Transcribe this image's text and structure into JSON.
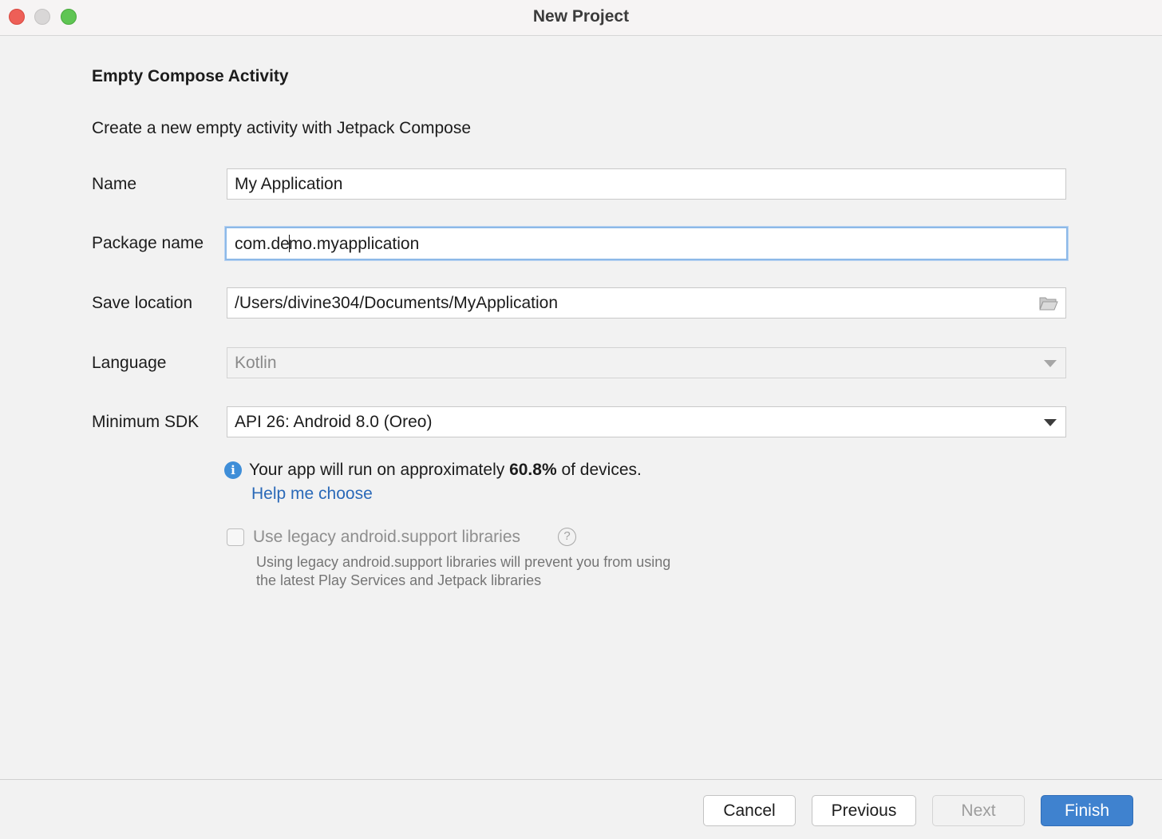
{
  "window": {
    "title": "New Project"
  },
  "section": {
    "title": "Empty Compose Activity",
    "description": "Create a new empty activity with Jetpack Compose"
  },
  "form": {
    "name_label": "Name",
    "name_value": "My Application",
    "package_label": "Package name",
    "package_value_before_caret": "com.de",
    "package_value_after_caret": "mo.myapplication",
    "save_location_label": "Save location",
    "save_location_value": "/Users/divine304/Documents/MyApplication",
    "language_label": "Language",
    "language_value": "Kotlin",
    "min_sdk_label": "Minimum SDK",
    "min_sdk_value": "API 26: Android 8.0 (Oreo)"
  },
  "info": {
    "prefix": "Your app will run on approximately ",
    "percent": "60.8%",
    "suffix": " of devices.",
    "help_link": "Help me choose"
  },
  "legacy": {
    "checkbox_label": "Use legacy android.support libraries",
    "checked": false,
    "hint_line1": "Using legacy android.support libraries will prevent you from using",
    "hint_line2": "the latest Play Services and Jetpack libraries"
  },
  "buttons": {
    "cancel": "Cancel",
    "previous": "Previous",
    "next": "Next",
    "finish": "Finish"
  },
  "colors": {
    "accent": "#3f82cf",
    "link": "#2a69b8",
    "info_icon": "#3f8ed8",
    "focus_ring": "#8db9e8"
  },
  "icons": {
    "save_location": "folder-icon",
    "info": "info-icon",
    "help": "help-icon",
    "dropdown": "chevron-down-icon"
  }
}
